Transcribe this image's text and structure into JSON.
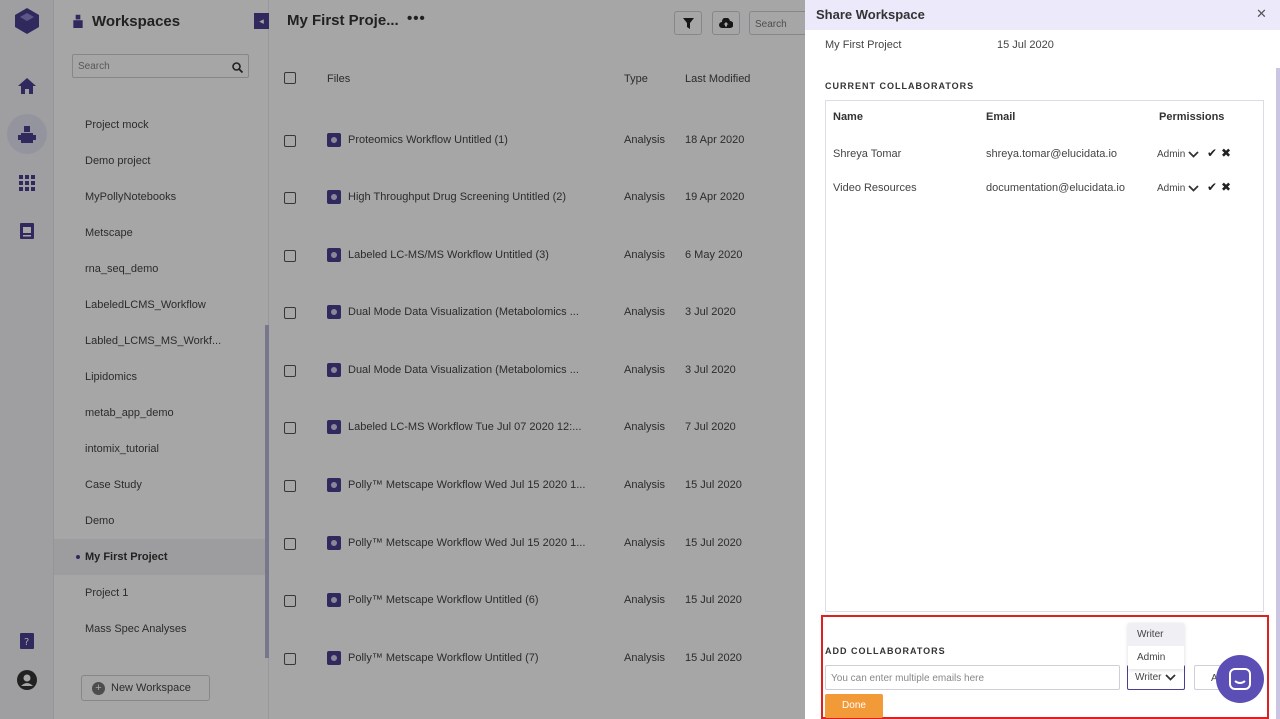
{
  "rail": {
    "icons": [
      "logo-icon",
      "home-icon",
      "workspaces-icon",
      "apps-grid-icon",
      "notebook-icon",
      "help-icon",
      "profile-icon"
    ]
  },
  "workspaces": {
    "title": "Workspaces",
    "search_placeholder": "Search",
    "items": [
      {
        "label": "Project mock"
      },
      {
        "label": "Demo project"
      },
      {
        "label": "MyPollyNotebooks"
      },
      {
        "label": "Metscape"
      },
      {
        "label": "rna_seq_demo"
      },
      {
        "label": "LabeledLCMS_Workflow"
      },
      {
        "label": "Labled_LCMS_MS_Workf..."
      },
      {
        "label": "Lipidomics"
      },
      {
        "label": "metab_app_demo"
      },
      {
        "label": "intomix_tutorial"
      },
      {
        "label": "Case Study"
      },
      {
        "label": "Demo"
      },
      {
        "label": "My First Project"
      },
      {
        "label": "Project 1"
      },
      {
        "label": "Mass Spec Analyses"
      }
    ],
    "active_item": "My First Project",
    "new_button": "New Workspace"
  },
  "main": {
    "title": "My First Proje...",
    "search_placeholder": "Search",
    "columns": {
      "files": "Files",
      "type": "Type",
      "modified": "Last Modified"
    },
    "rows": [
      {
        "name": "Proteomics Workflow Untitled (1)",
        "type": "Analysis",
        "modified": "18 Apr 2020"
      },
      {
        "name": "High Throughput Drug Screening Untitled (2)",
        "type": "Analysis",
        "modified": "19 Apr 2020"
      },
      {
        "name": "Labeled LC-MS/MS Workflow Untitled (3)",
        "type": "Analysis",
        "modified": "6 May 2020"
      },
      {
        "name": "Dual Mode Data Visualization (Metabolomics ...",
        "type": "Analysis",
        "modified": "3 Jul 2020"
      },
      {
        "name": "Dual Mode Data Visualization (Metabolomics ...",
        "type": "Analysis",
        "modified": "3 Jul 2020"
      },
      {
        "name": "Labeled LC-MS Workflow Tue Jul 07 2020 12:...",
        "type": "Analysis",
        "modified": "7 Jul 2020"
      },
      {
        "name": "Polly™ Metscape Workflow Wed Jul 15 2020 1...",
        "type": "Analysis",
        "modified": "15 Jul 2020"
      },
      {
        "name": "Polly™ Metscape Workflow Wed Jul 15 2020 1...",
        "type": "Analysis",
        "modified": "15 Jul 2020"
      },
      {
        "name": "Polly™ Metscape Workflow Untitled (6)",
        "type": "Analysis",
        "modified": "15 Jul 2020"
      },
      {
        "name": "Polly™ Metscape Workflow Untitled (7)",
        "type": "Analysis",
        "modified": "15 Jul 2020"
      }
    ]
  },
  "share": {
    "title": "Share Workspace",
    "project_name": "My First Project",
    "project_date": "15 Jul 2020",
    "current_heading": "CURRENT COLLABORATORS",
    "columns": {
      "name": "Name",
      "email": "Email",
      "permissions": "Permissions"
    },
    "collaborators": [
      {
        "name": "Shreya Tomar",
        "email": "shreya.tomar@elucidata.io",
        "permission": "Admin"
      },
      {
        "name": "Video Resources",
        "email": "documentation@elucidata.io",
        "permission": "Admin"
      }
    ],
    "add_heading": "ADD COLLABORATORS",
    "email_placeholder": "You can enter multiple emails here",
    "permission_selected": "Writer",
    "permission_options": [
      "Writer",
      "Admin"
    ],
    "add_button": "Add",
    "done_button": "Done"
  },
  "colors": {
    "brand": "#4b3f8f",
    "drawer_header": "#ece9fa",
    "done_button": "#f39a38",
    "highlight_box": "#e02020"
  }
}
